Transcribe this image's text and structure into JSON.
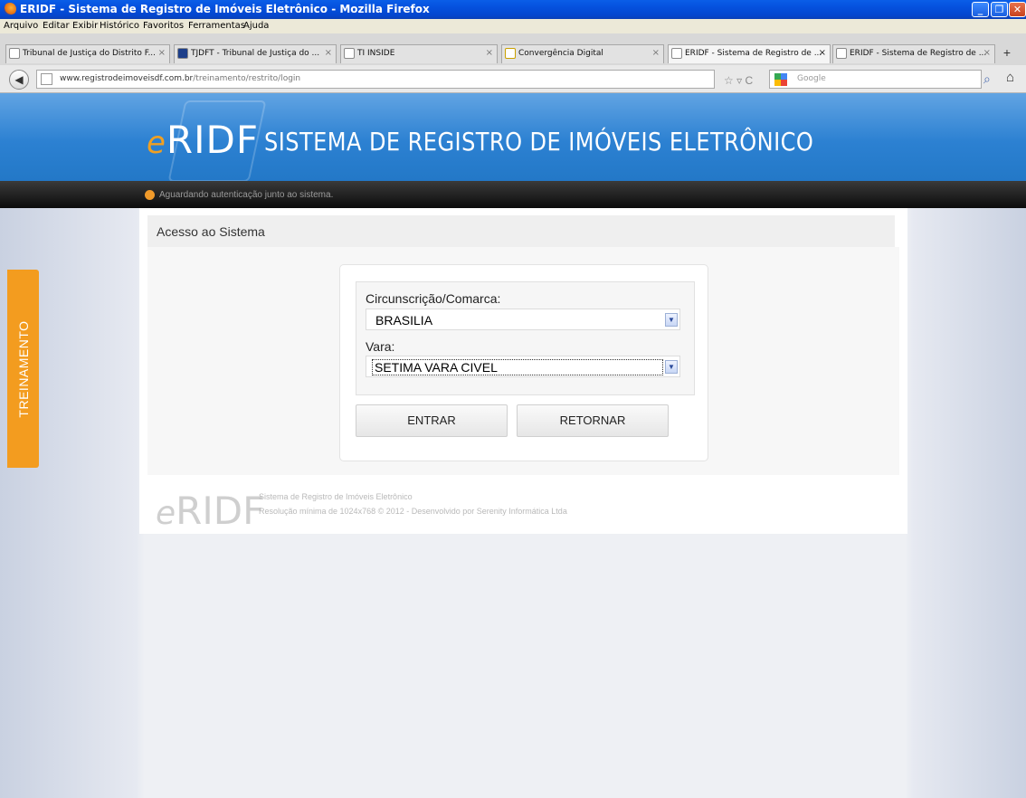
{
  "window": {
    "title": "ERIDF - Sistema de Registro de Imóveis Eletrônico - Mozilla Firefox"
  },
  "menu": [
    "Arquivo",
    "Editar",
    "Exibir",
    "Histórico",
    "Favoritos",
    "Ferramentas",
    "Ajuda"
  ],
  "tabs": [
    {
      "label": "Tribunal de Justiça do Distrito F..."
    },
    {
      "label": "TJDFT - Tribunal de Justiça do ..."
    },
    {
      "label": "TI INSIDE"
    },
    {
      "label": "Convergência Digital"
    },
    {
      "label": "ERIDF - Sistema de Registro de ..."
    },
    {
      "label": "ERIDF - Sistema de Registro de ..."
    }
  ],
  "nav": {
    "url_domain": "www.registrodeimoveisdf.com.br",
    "url_path": "/treinamento/restrito/login",
    "search_placeholder": "Google"
  },
  "header": {
    "logo_prefix": "e",
    "logo_main": "RIDF",
    "slogan": "SISTEMA DE REGISTRO DE IMÓVEIS ELETRÔNICO",
    "status_message": "Aguardando autenticação junto ao sistema."
  },
  "side_badge": "TREINAMENTO",
  "main": {
    "section_title": "Acesso ao Sistema",
    "field1_label": "Circunscrição/Comarca:",
    "field1_value": "BRASILIA",
    "field2_label": "Vara:",
    "field2_value": "SETIMA VARA CIVEL",
    "enter_label": "ENTRAR",
    "return_label": "RETORNAR"
  },
  "footer": {
    "logo_prefix": "e",
    "logo_main": "RIDF",
    "line1": "Sistema de Registro de Imóveis Eletrônico",
    "line2": "Resolução mínima de 1024x768 © 2012 - Desenvolvido por Serenity Informática Ltda"
  }
}
